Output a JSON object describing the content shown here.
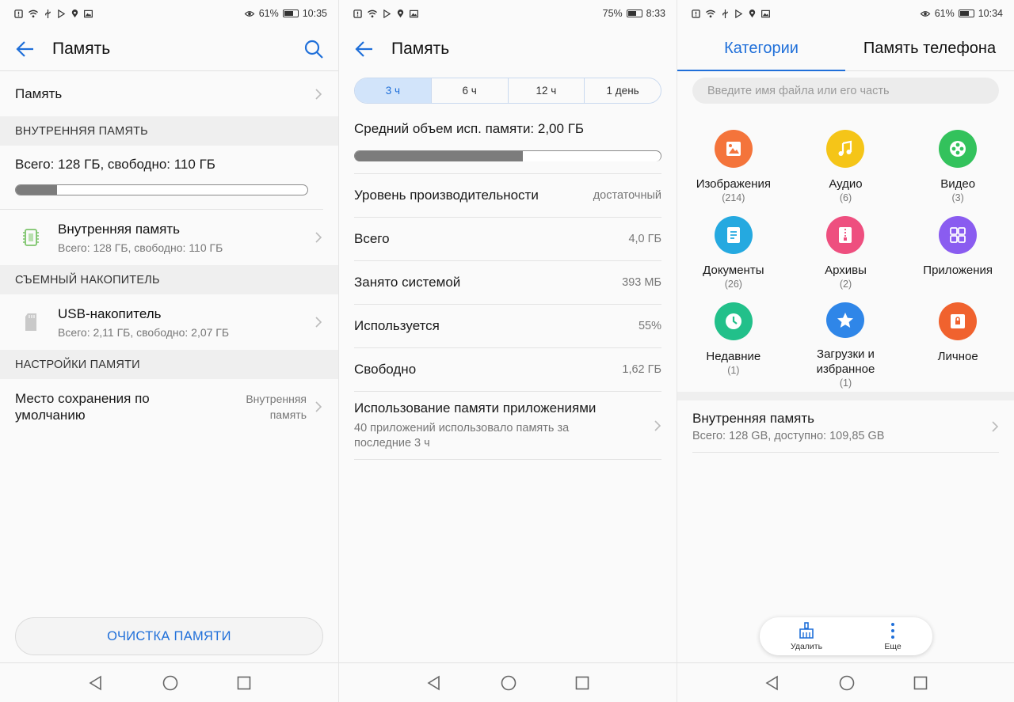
{
  "screen1": {
    "status": {
      "battery": "61%",
      "time": "10:35"
    },
    "title": "Память",
    "memory_row": "Память",
    "section_internal": "ВНУТРЕННЯЯ ПАМЯТЬ",
    "total_text": "Всего: 128 ГБ, свободно: 110 ГБ",
    "used_fraction": 0.14,
    "internal_item": {
      "title": "Внутренняя память",
      "subtitle": "Всего: 128 ГБ, свободно: 110 ГБ"
    },
    "section_removable": "СЪЕМНЫЙ НАКОПИТЕЛЬ",
    "usb_item": {
      "title": "USB-накопитель",
      "subtitle": "Всего: 2,11 ГБ, свободно: 2,07 ГБ"
    },
    "section_settings": "НАСТРОЙКИ ПАМЯТИ",
    "default_location": {
      "label_line1": "Место сохранения по",
      "label_line2": "умолчанию",
      "value_line1": "Внутренняя",
      "value_line2": "память"
    },
    "clean_button": "ОЧИСТКА ПАМЯТИ"
  },
  "screen2": {
    "status": {
      "battery": "75%",
      "time": "8:33"
    },
    "title": "Память",
    "ranges": [
      "3 ч",
      "6 ч",
      "12 ч",
      "1 день"
    ],
    "active_range": 0,
    "avg_label": "Средний объем исп. памяти: 2,00 ГБ",
    "avg_fraction": 0.55,
    "rows": [
      {
        "key": "Уровень производительности",
        "value": "достаточный"
      },
      {
        "key": "Всего",
        "value": "4,0 ГБ"
      },
      {
        "key": "Занято системой",
        "value": "393 МБ"
      },
      {
        "key": "Используется",
        "value": "55%"
      },
      {
        "key": "Свободно",
        "value": "1,62 ГБ"
      }
    ],
    "apps_usage": {
      "title": "Использование памяти приложениями",
      "sub_line1": "40 приложений использовало память за",
      "sub_line2": "последние 3 ч"
    }
  },
  "screen3": {
    "status": {
      "battery": "61%",
      "time": "10:34"
    },
    "tab_active": "Категории",
    "tab_other": "Память телефона",
    "search_placeholder": "Введите имя файла или его часть",
    "categories": [
      {
        "name": "Изображения",
        "count": "(214)",
        "color": "#f4743b",
        "icon": "image-icon"
      },
      {
        "name": "Аудио",
        "count": "(6)",
        "color": "#f5c518",
        "icon": "music-icon"
      },
      {
        "name": "Видео",
        "count": "(3)",
        "color": "#33c25c",
        "icon": "film-icon"
      },
      {
        "name": "Документы",
        "count": "(26)",
        "color": "#25a9e0",
        "icon": "document-icon"
      },
      {
        "name": "Архивы",
        "count": "(2)",
        "color": "#ee4f7f",
        "icon": "archive-icon"
      },
      {
        "name": "Приложения",
        "count": "",
        "color": "#8a5cf0",
        "icon": "apps-icon"
      },
      {
        "name": "Недавние",
        "count": "(1)",
        "color": "#22c08a",
        "icon": "clock-icon"
      },
      {
        "name": "Загрузки и избранное",
        "count": "(1)",
        "color": "#2f86e8",
        "icon": "star-icon"
      },
      {
        "name": "Личное",
        "count": "",
        "color": "#f0622e",
        "icon": "safe-icon"
      }
    ],
    "internal": {
      "title": "Внутренняя память",
      "subtitle": "Всего: 128 GB, доступно: 109,85 GB"
    },
    "fab": {
      "delete": "Удалить",
      "more": "Еще"
    }
  }
}
